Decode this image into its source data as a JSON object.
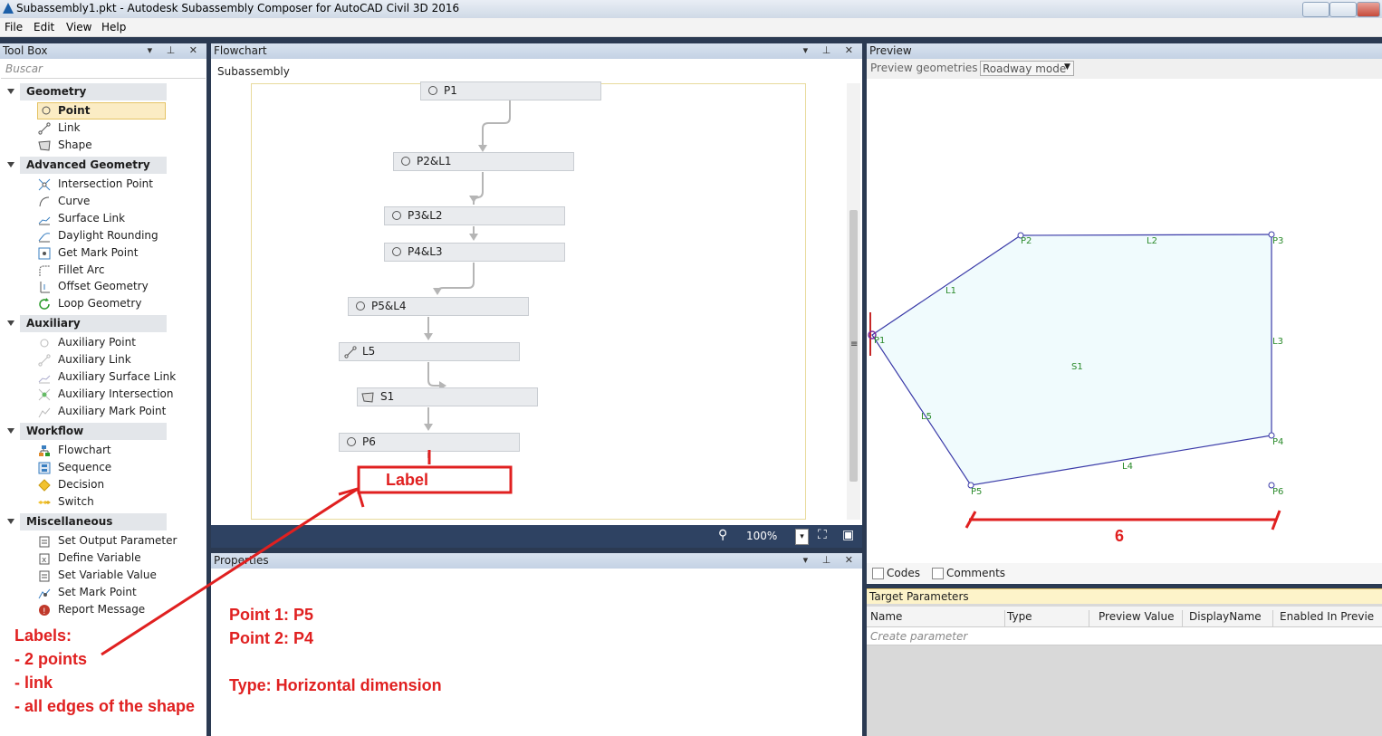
{
  "window": {
    "title": "Subassembly1.pkt - Autodesk Subassembly Composer for AutoCAD Civil 3D 2016"
  },
  "menu": [
    "File",
    "Edit",
    "View",
    "Help"
  ],
  "toolbox": {
    "title": "Tool Box",
    "search_placeholder": "Buscar",
    "categories": [
      {
        "name": "Geometry",
        "items": [
          {
            "label": "Point",
            "icon": "point-icon",
            "selected": true
          },
          {
            "label": "Link",
            "icon": "link-icon"
          },
          {
            "label": "Shape",
            "icon": "shape-icon"
          }
        ]
      },
      {
        "name": "Advanced Geometry",
        "items": [
          {
            "label": "Intersection Point",
            "icon": "intersection-point-icon"
          },
          {
            "label": "Curve",
            "icon": "curve-icon"
          },
          {
            "label": "Surface Link",
            "icon": "surface-link-icon"
          },
          {
            "label": "Daylight Rounding",
            "icon": "daylight-rounding-icon"
          },
          {
            "label": "Get Mark Point",
            "icon": "get-mark-point-icon"
          },
          {
            "label": "Fillet Arc",
            "icon": "fillet-arc-icon"
          },
          {
            "label": "Offset Geometry",
            "icon": "offset-geometry-icon"
          },
          {
            "label": "Loop Geometry",
            "icon": "loop-geometry-icon"
          }
        ]
      },
      {
        "name": "Auxiliary",
        "items": [
          {
            "label": "Auxiliary Point",
            "icon": "auxiliary-point-icon"
          },
          {
            "label": "Auxiliary Link",
            "icon": "auxiliary-link-icon"
          },
          {
            "label": "Auxiliary Surface Link",
            "icon": "auxiliary-surface-link-icon"
          },
          {
            "label": "Auxiliary Intersection",
            "icon": "auxiliary-intersection-icon"
          },
          {
            "label": "Auxiliary Mark Point",
            "icon": "auxiliary-mark-point-icon"
          }
        ]
      },
      {
        "name": "Workflow",
        "items": [
          {
            "label": "Flowchart",
            "icon": "flowchart-icon"
          },
          {
            "label": "Sequence",
            "icon": "sequence-icon"
          },
          {
            "label": "Decision",
            "icon": "decision-icon"
          },
          {
            "label": "Switch",
            "icon": "switch-icon"
          }
        ]
      },
      {
        "name": "Miscellaneous",
        "items": [
          {
            "label": "Set Output Parameter",
            "icon": "set-output-parameter-icon"
          },
          {
            "label": "Define Variable",
            "icon": "define-variable-icon"
          },
          {
            "label": "Set Variable Value",
            "icon": "set-variable-value-icon"
          },
          {
            "label": "Set Mark Point",
            "icon": "set-mark-point-icon"
          },
          {
            "label": "Report Message",
            "icon": "report-message-icon"
          }
        ]
      }
    ]
  },
  "flowchart": {
    "title": "Flowchart",
    "breadcrumb": "Subassembly",
    "nodes": [
      {
        "label": "P1",
        "icon": "point-icon"
      },
      {
        "label": "P2&L1",
        "icon": "point-icon"
      },
      {
        "label": "P3&L2",
        "icon": "point-icon"
      },
      {
        "label": "P4&L3",
        "icon": "point-icon"
      },
      {
        "label": "P5&L4",
        "icon": "point-icon"
      },
      {
        "label": "L5",
        "icon": "link-icon"
      },
      {
        "label": "S1",
        "icon": "shape-icon"
      },
      {
        "label": "P6",
        "icon": "point-icon"
      }
    ],
    "zoom": "100%"
  },
  "properties": {
    "title": "Properties",
    "lines": [
      "Point 1:  P5",
      "Point 2: P4",
      "Type: Horizontal dimension"
    ]
  },
  "preview": {
    "title": "Preview",
    "geometries_label": "Preview geometries in",
    "mode": "Roadway mode",
    "points": [
      "P1",
      "P2",
      "P3",
      "P4",
      "P5",
      "P6"
    ],
    "links": [
      "L1",
      "L2",
      "L3",
      "L4",
      "L5"
    ],
    "shape": "S1",
    "codes_label": "Codes",
    "comments_label": "Comments"
  },
  "target_parameters": {
    "title": "Target Parameters",
    "columns": [
      "Name",
      "Type",
      "Preview Value",
      "DisplayName",
      "Enabled In Previe"
    ],
    "create_placeholder": "Create parameter"
  },
  "annotations": {
    "label_box": "Label",
    "dimension_value": "6",
    "notes": [
      "Labels:",
      "- 2 points",
      "- link",
      "- all edges of the shape"
    ],
    "color": "#e02020"
  }
}
